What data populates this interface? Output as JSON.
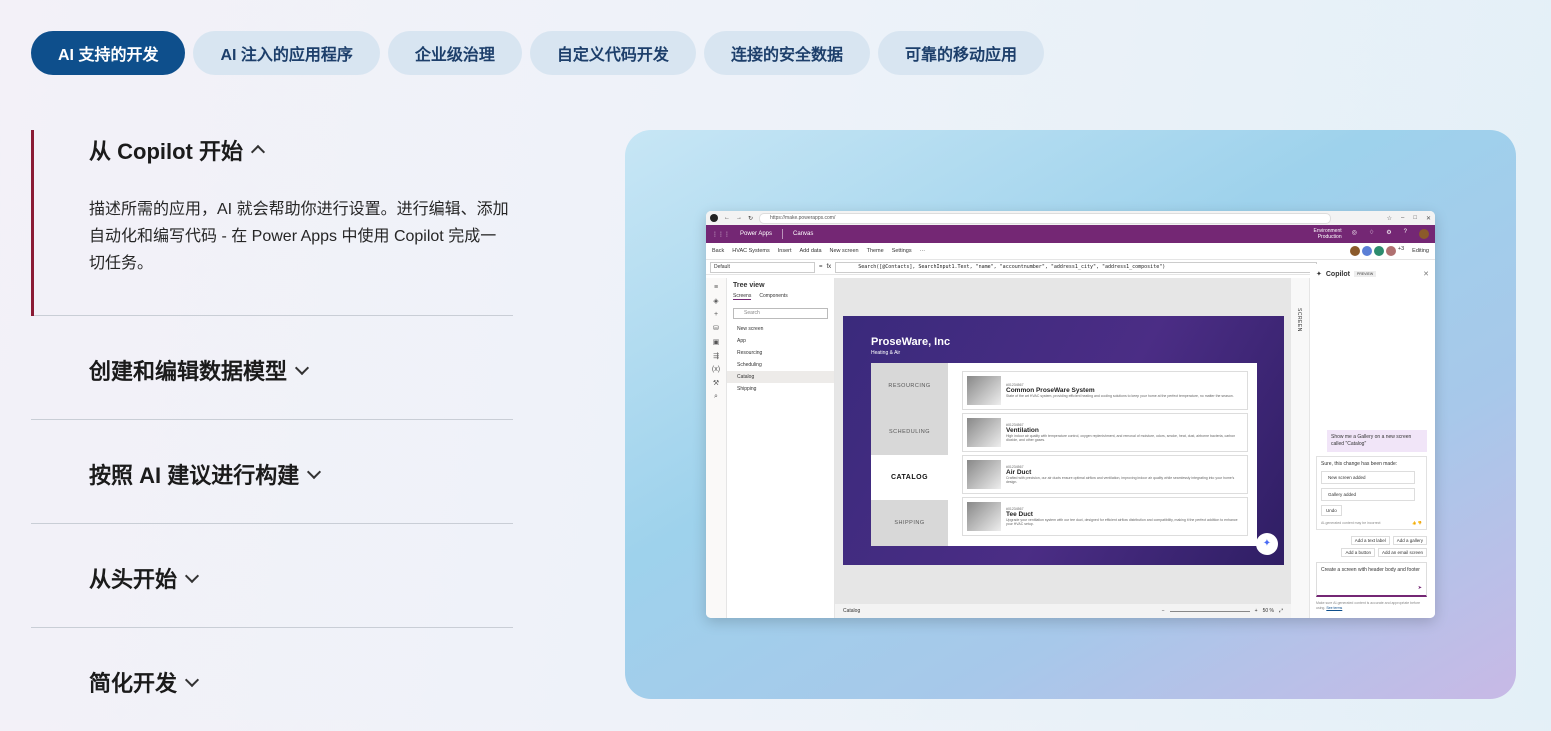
{
  "tabs": [
    {
      "label": "AI 支持的开发",
      "active": true
    },
    {
      "label": "AI 注入的应用程序",
      "active": false
    },
    {
      "label": "企业级治理",
      "active": false
    },
    {
      "label": "自定义代码开发",
      "active": false
    },
    {
      "label": "连接的安全数据",
      "active": false
    },
    {
      "label": "可靠的移动应用",
      "active": false
    }
  ],
  "accordion": {
    "open": {
      "title": "从 Copilot 开始",
      "body": "描述所需的应用，AI 就会帮助你进行设置。进行编辑、添加自动化和编写代码 - 在 Power Apps 中使用 Copilot 完成一切任务。"
    },
    "items": [
      {
        "title": "创建和编辑数据模型"
      },
      {
        "title": "按照 AI 建议进行构建"
      },
      {
        "title": "从头开始"
      },
      {
        "title": "简化开发"
      }
    ]
  },
  "accent_colors": {
    "active_tab": "#0e4f8c",
    "open_bar": "#8a1b35",
    "power_apps": "#742774"
  },
  "app": {
    "url": "https://make.powerapps.com/",
    "product": "Power Apps",
    "mode": "Canvas",
    "env_label": "Environment",
    "env_name": "Production",
    "cmd": {
      "back": "Back",
      "app_name": "HVAC Systems",
      "insert": "Insert",
      "add_data": "Add data",
      "new_screen": "New screen",
      "theme": "Theme",
      "settings": "Settings",
      "editing": "Editing",
      "avatars_more": "+3"
    },
    "property": "Default",
    "formula": "Search([@Contacts], SearchInput1.Text, \"name\", \"accountnumber\", \"address1_city\", \"address1_composite\")",
    "tree": {
      "title": "Tree view",
      "tab_screens": "Screens",
      "tab_components": "Components",
      "search_placeholder": "Search",
      "new_screen": "New screen",
      "nodes": [
        "App",
        "Resourcing",
        "Scheduling",
        "Catalog",
        "Shipping"
      ]
    },
    "screen": {
      "brand": "ProseWare, Inc",
      "tagline": "Heating & Air",
      "menu": [
        "RESOURCING",
        "SCHEDULING",
        "CATALOG",
        "SHIPPING"
      ],
      "products": [
        {
          "num": "#01234567",
          "name": "Common ProseWare System",
          "desc": "State of the art HVAC system, providing efficient heating and cooling solutions to keep your home at the perfect temperature, no matter the season."
        },
        {
          "num": "#01234567",
          "name": "Ventilation",
          "desc": "High indoor air quality with temperature control, oxygen replenishment, and removal of moisture, odors, smoke, heat, dust, airborne bacteria, carbon dioxide, and other gases."
        },
        {
          "num": "#01234567",
          "name": "Air Duct",
          "desc": "Crafted with precision, our air ducts ensure optimal airflow and ventilation, improving indoor air quality while seamlessly integrating into your home's design."
        },
        {
          "num": "#01234567",
          "name": "Tee Duct",
          "desc": "Upgrade your ventilation system with our tee duct, designed for efficient airflow distribution and compatibility, making it the perfect addition to enhance your HVAC setup."
        }
      ]
    },
    "footer": {
      "screen_name": "Catalog",
      "zoom": "50 %"
    },
    "side_strip": "SCREEN",
    "copilot": {
      "title": "Copilot",
      "badge": "PREVIEW",
      "user_msg": "Show me a Gallery on a new screen called \"Catalog\"",
      "reply_title": "Sure, this change has been made:",
      "change_1": "New screen added",
      "change_2": "Gallery added",
      "undo": "Undo",
      "ai_note": "AI-generated content may be incorrect",
      "suggestions": [
        "Add a text label",
        "Add a gallery",
        "Add a button",
        "Add an email screen"
      ],
      "input_text": "Create a screen with header body and footer",
      "disclaimer": "Make sure AI-generated content is accurate and appropriate before using.",
      "see_terms": "See terms"
    }
  }
}
